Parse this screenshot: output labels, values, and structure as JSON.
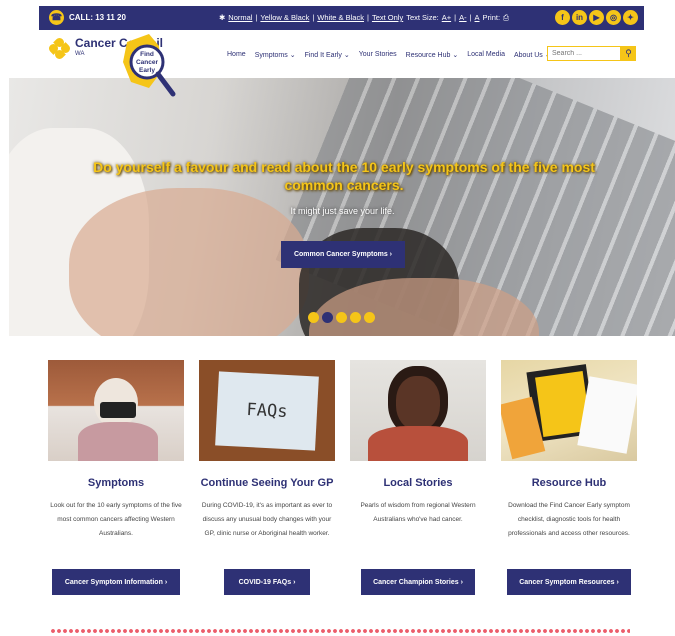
{
  "topbar": {
    "call": "CALL: 13 11 20",
    "accessibility": {
      "normal": "Normal",
      "yellow_black": "Yellow & Black",
      "white_black": "White & Black",
      "text_only": "Text Only",
      "text_size_label": "Text Size:",
      "size_up": "A+",
      "size_down": "A-",
      "size_reset": "A",
      "print_label": "Print:"
    },
    "social": [
      "f",
      "in",
      "yt",
      "ig",
      "tw"
    ],
    "social_icons": [
      "facebook-icon",
      "linkedin-icon",
      "youtube-icon",
      "instagram-icon",
      "twitter-icon"
    ]
  },
  "logo": {
    "name": "Cancer Council",
    "region": "WA",
    "badge": [
      "Find",
      "Cancer",
      "Early"
    ]
  },
  "nav": [
    {
      "label": "Home",
      "dropdown": false
    },
    {
      "label": "Symptoms",
      "dropdown": true
    },
    {
      "label": "Find It Early",
      "dropdown": true
    },
    {
      "label": "Your Stories",
      "dropdown": false
    },
    {
      "label": "Resource Hub",
      "dropdown": true
    },
    {
      "label": "Local Media",
      "dropdown": false
    },
    {
      "label": "About Us",
      "dropdown": true
    }
  ],
  "search": {
    "placeholder": "Search ..."
  },
  "hero": {
    "headline": "Do yourself a favour and read about the 10 early symptoms of the five most common cancers.",
    "subline": "It might just save your life.",
    "cta": "Common Cancer Symptoms",
    "slides": 5,
    "active_slide": 2
  },
  "cards": [
    {
      "title": "Symptoms",
      "text": "Look out for the 10 early symptoms of the five most common cancers affecting Western Australians.",
      "button": "Cancer Symptom Information"
    },
    {
      "title": "Continue Seeing Your GP",
      "text": "During COVID-19, it's as important as ever to discuss any unusual body changes with your GP, clinic nurse or Aboriginal health worker.",
      "button": "COVID-19 FAQs",
      "image_text": "FAQs"
    },
    {
      "title": "Local Stories",
      "text": "Pearls of wisdom from regional Western Australians who've had cancer.",
      "button": "Cancer Champion Stories"
    },
    {
      "title": "Resource Hub",
      "text": "Download the Find Cancer Early symptom checklist, diagnostic tools for health professionals and access other resources.",
      "button": "Cancer Symptom Resources"
    }
  ],
  "colors": {
    "brand_navy": "#2e3175",
    "brand_yellow": "#f5c518",
    "accent_red": "#e94b5a"
  }
}
